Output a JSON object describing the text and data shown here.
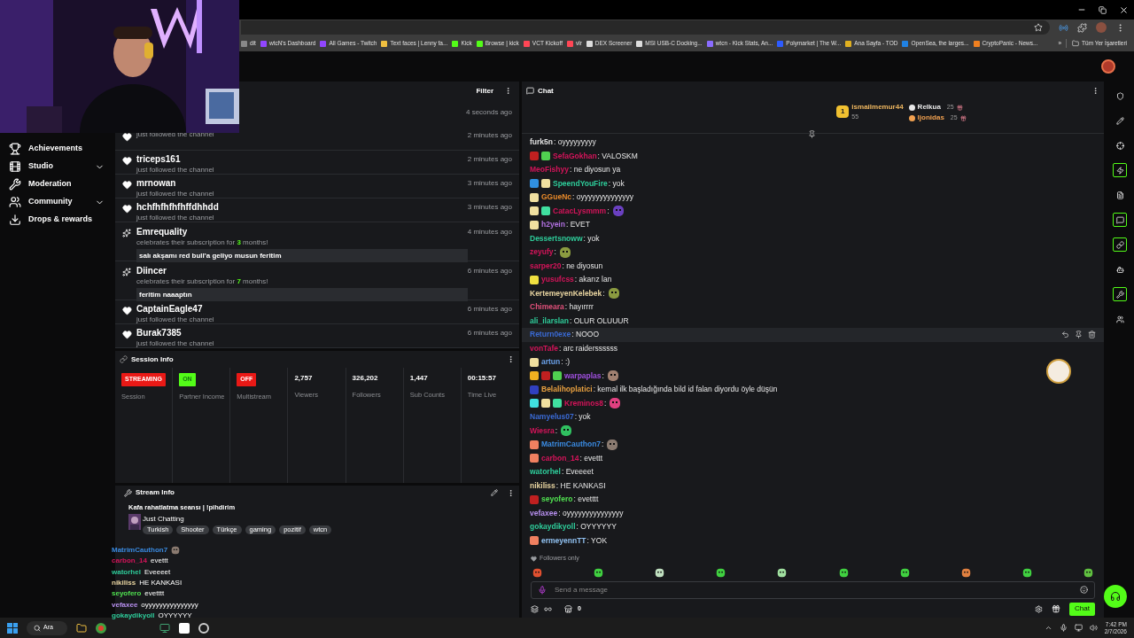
{
  "bookmarks": [
    {
      "label": "dit",
      "color": "#888888"
    },
    {
      "label": "wtcN's Dashboard",
      "color": "#9146ff"
    },
    {
      "label": "All Games - Twitch",
      "color": "#9146ff"
    },
    {
      "label": "Text faces | Lenny fa...",
      "color": "#f0c040"
    },
    {
      "label": "Kick",
      "color": "#53fc18"
    },
    {
      "label": "Browse | kick",
      "color": "#53fc18"
    },
    {
      "label": "VCT Kickoff",
      "color": "#ff4655"
    },
    {
      "label": "vlr",
      "color": "#ff4655"
    },
    {
      "label": "DEX Screener",
      "color": "#dddddd"
    },
    {
      "label": "MSI USB-C Docking...",
      "color": "#dddddd"
    },
    {
      "label": "wtcn - Kick Stats, An...",
      "color": "#8a6cff"
    },
    {
      "label": "Polymarket | The W...",
      "color": "#2d5bff"
    },
    {
      "label": "Ana Sayfa - TOD",
      "color": "#e0b020"
    },
    {
      "label": "OpenSea, the larges...",
      "color": "#2081e2"
    },
    {
      "label": "CryptoPanic - News...",
      "color": "#f08020"
    }
  ],
  "bookmarks_more": "»",
  "bookmarks_all": "Tüm Yer İşaretleri",
  "sidebar": {
    "items": [
      {
        "label": "Achievements",
        "expandable": false
      },
      {
        "label": "Studio",
        "expandable": true
      },
      {
        "label": "Moderation",
        "expandable": false
      },
      {
        "label": "Community",
        "expandable": true
      },
      {
        "label": "Drops & rewards",
        "expandable": false
      }
    ]
  },
  "activity": {
    "filter": "Filter",
    "items": [
      {
        "kind": "none",
        "time": "4 seconds ago"
      },
      {
        "kind": "follow",
        "desc": "just followed the channel",
        "time": "2 minutes ago"
      },
      {
        "kind": "follow",
        "user": "triceps161",
        "desc": "just followed the channel",
        "time": "2 minutes ago"
      },
      {
        "kind": "follow",
        "user": "mrnowan",
        "desc": "just followed the channel",
        "time": "3 minutes ago"
      },
      {
        "kind": "follow",
        "user": "hchfhfhfhfhffdhhdd",
        "desc": "just followed the channel",
        "time": "3 minutes ago"
      },
      {
        "kind": "sub",
        "user": "Emrequality",
        "desc": "celebrates their subscription for **3** months!",
        "message": "salı akşamı red bull'a geliyo musun feritim",
        "time": "4 minutes ago"
      },
      {
        "kind": "sub",
        "user": "Diincer",
        "desc": "celebrates their subscription for **7** months!",
        "message": "feritim naaaptın",
        "time": "6 minutes ago"
      },
      {
        "kind": "follow",
        "user": "CaptainEagle47",
        "desc": "just followed the channel",
        "time": "6 minutes ago"
      },
      {
        "kind": "follow",
        "user": "Burak7385",
        "desc": "just followed the channel",
        "time": "6 minutes ago"
      }
    ]
  },
  "session_info": {
    "title": "Session Info",
    "stats": [
      {
        "kind": "badge",
        "value": "STREAMING",
        "color": "#e91916",
        "label": "Session"
      },
      {
        "kind": "badge",
        "value": "ON",
        "color": "#53fc18",
        "label": "Partner Income"
      },
      {
        "kind": "badge",
        "value": "OFF",
        "color": "#e91916",
        "label": "Multistream"
      },
      {
        "kind": "stat",
        "value": "2,757",
        "label": "Viewers"
      },
      {
        "kind": "stat",
        "value": "326,202",
        "label": "Followers"
      },
      {
        "kind": "stat",
        "value": "1,447",
        "label": "Sub Counts"
      },
      {
        "kind": "stat",
        "value": "00:15:57",
        "label": "Time Live"
      }
    ]
  },
  "stream_info": {
    "title": "Stream Info",
    "stream_title": "Kafa rahatlatma seansı | !pihdirim",
    "category": "Just Chatting",
    "tags": [
      "Turkish",
      "Shooter",
      "Türkçe",
      "gaming",
      "pozitif",
      "wtcn"
    ]
  },
  "overlay_chat": [
    {
      "user": "MatrimCauthon7",
      "color": "#3a8ae0",
      "emote": {
        "color": "#8a7a70"
      }
    },
    {
      "user": "carbon_14",
      "color": "#d4145a",
      "text": "evettt"
    },
    {
      "user": "watorhel",
      "color": "#2ecc9a",
      "text": "Eveeeet"
    },
    {
      "user": "nikiliss",
      "color": "#e8d4a0",
      "text": "HE KANKASI"
    },
    {
      "user": "seyofero",
      "color": "#50e050",
      "text": "evetttt"
    },
    {
      "user": "vefaxee",
      "color": "#b890f0",
      "text": "oyyyyyyyyyyyyyyy"
    },
    {
      "user": "gokaydikyoll",
      "color": "#2ecc9a",
      "text": "OYYYYYY"
    }
  ],
  "chat": {
    "title": "Chat",
    "leaderboard": [
      {
        "rank": "1",
        "user": "ismailmemur44",
        "amount": "55",
        "color": "#f0b860"
      },
      {
        "user": "Relkua",
        "amount": "25",
        "color": "#e8e8e8"
      },
      {
        "user": "ljonidas",
        "amount": "25",
        "color": "#f0a050"
      }
    ],
    "messages": [
      {
        "user": "furk5n",
        "color": "#e0e0e0",
        "text": ": oyyyyyyyyy",
        "hovered": false
      },
      {
        "user": "SefaGokhan",
        "color": "#d4145a",
        "text": ": VALOSKM",
        "badges": [
          {
            "color": "#c02020"
          },
          {
            "color": "#50d050"
          }
        ],
        "hovered": false
      },
      {
        "user": "MeoFishyy",
        "color": "#d4145a",
        "text": ": ne diyosun ya",
        "hovered": false
      },
      {
        "user": "SpeendYouFire",
        "color": "#2ecc9a",
        "text": ": yok",
        "badges": [
          {
            "color": "#3090e0"
          },
          {
            "color": "#f0e0a0"
          }
        ],
        "hovered": false
      },
      {
        "user": "GGueNc",
        "color": "#e88a2a",
        "text": ": oyyyyyyyyyyyyyy",
        "badges": [
          {
            "color": "#f0e0a0"
          }
        ],
        "hovered": false
      },
      {
        "user": "CatacLysmmm",
        "color": "#d4145a",
        "text": ":",
        "emote": {
          "color": "#6a40c0"
        },
        "badges": [
          {
            "color": "#f0e0a0"
          },
          {
            "color": "#40e0a0"
          }
        ],
        "hovered": false
      },
      {
        "user": "h2yein",
        "color": "#b070e0",
        "text": ": EVET",
        "badges": [
          {
            "color": "#f0e0a0"
          }
        ],
        "hovered": false
      },
      {
        "user": "Dessertsnoww",
        "color": "#2ecc9a",
        "text": ": yok",
        "hovered": false
      },
      {
        "user": "zeyufy",
        "color": "#d4145a",
        "text": ":",
        "emote": {
          "color": "#8a9a40"
        },
        "hovered": false
      },
      {
        "user": "sarper20",
        "color": "#d4145a",
        "text": ": ne diyosun",
        "hovered": false
      },
      {
        "user": "yusufcss",
        "color": "#d4145a",
        "text": ": akarız lan",
        "badges": [
          {
            "color": "#f0e040"
          }
        ],
        "hovered": false
      },
      {
        "user": "KertemeyenKelebek",
        "color": "#e8d4a0",
        "text": ":",
        "emote": {
          "color": "#8a9a40"
        },
        "hovered": false
      },
      {
        "user": "Chimeara",
        "color": "#e0507a",
        "text": ": hayırrrr",
        "hovered": false
      },
      {
        "user": "ali_ilarslan",
        "color": "#2ecc9a",
        "text": ": OLUR OLUUUR",
        "hovered": false
      },
      {
        "user": "Return0exe",
        "color": "#3a6ad4",
        "text": ": NOOO",
        "hovered": true
      },
      {
        "user": "vonTafe",
        "color": "#d4145a",
        "text": ": arc raiderssssss",
        "hovered": false
      },
      {
        "user": "artun",
        "color": "#6aa0e8",
        "text": ": :)",
        "badges": [
          {
            "color": "#f0e0a0"
          }
        ],
        "hovered": false
      },
      {
        "user": "warpaplas",
        "color": "#a050e0",
        "text": ":",
        "emote": {
          "color": "#a08070"
        },
        "badges": [
          {
            "color": "#f0b020"
          },
          {
            "color": "#c02020"
          },
          {
            "color": "#50d050"
          }
        ],
        "hovered": false
      },
      {
        "user": "Belalihoplatici",
        "color": "#e8a040",
        "text": ": kemal ilk başladığında bild id falan diyordu öyle düşün",
        "badges": [
          {
            "color": "#3040c0"
          }
        ],
        "hovered": false
      },
      {
        "user": "Kreminos8",
        "color": "#d4145a",
        "text": ":",
        "emote": {
          "color": "#e04080"
        },
        "badges": [
          {
            "color": "#40e0e0"
          },
          {
            "color": "#f0e0a0"
          },
          {
            "color": "#40e0a0"
          }
        ],
        "hovered": false
      },
      {
        "user": "Namyelus07",
        "color": "#3a6ad4",
        "text": ": yok",
        "hovered": false
      },
      {
        "user": "Wiesra",
        "color": "#d4145a",
        "text": ":",
        "emote": {
          "color": "#30c060"
        },
        "hovered": false
      },
      {
        "user": "MatrimCauthon7",
        "color": "#3a8ae0",
        "text": ":",
        "emote": {
          "color": "#8a7a70"
        },
        "badges": [
          {
            "color": "#f08060"
          }
        ],
        "hovered": false
      },
      {
        "user": "carbon_14",
        "color": "#d4145a",
        "text": ": evettt",
        "badges": [
          {
            "color": "#f08060"
          }
        ],
        "hovered": false
      },
      {
        "user": "watorhel",
        "color": "#2ecc9a",
        "text": ": Eveeeet",
        "hovered": false
      },
      {
        "user": "nikiliss",
        "color": "#e8d4a0",
        "text": ": HE KANKASI",
        "hovered": false
      },
      {
        "user": "seyofero",
        "color": "#50e050",
        "text": ": evetttt",
        "badges": [
          {
            "color": "#c02020"
          }
        ],
        "hovered": false
      },
      {
        "user": "vefaxee",
        "color": "#b890f0",
        "text": ": oyyyyyyyyyyyyyyy",
        "hovered": false
      },
      {
        "user": "gokaydikyoll",
        "color": "#2ecc9a",
        "text": ": OYYYYYY",
        "hovered": false
      },
      {
        "user": "ermeyennTT",
        "color": "#90c0f0",
        "text": ": YOK",
        "badges": [
          {
            "color": "#f08060"
          }
        ],
        "hovered": false
      }
    ],
    "mode": "Followers only",
    "emotes": [
      {
        "color": "#e05030"
      },
      {
        "color": "#40d040"
      },
      {
        "color": "#c0e0c0"
      },
      {
        "color": "#40d040"
      },
      {
        "color": "#a0e0a0"
      },
      {
        "color": "#40d040"
      },
      {
        "color": "#40d040"
      },
      {
        "color": "#e08040"
      },
      {
        "color": "#40d040"
      },
      {
        "color": "#60c040"
      }
    ],
    "input": {
      "placeholder": "Send a message"
    },
    "points": "0",
    "send": "Chat"
  },
  "taskbar": {
    "search": "Ara",
    "time": "7:42 PM",
    "date": "2/7/2026"
  }
}
